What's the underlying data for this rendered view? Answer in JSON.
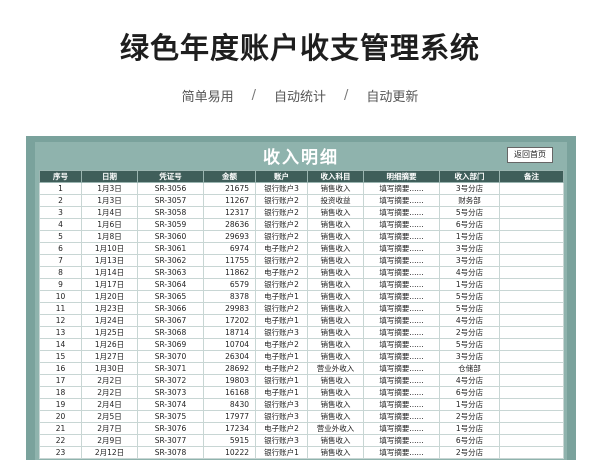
{
  "page": {
    "title": "绿色年度账户收支管理系统",
    "subtitle": [
      "简单易用",
      "自动统计",
      "自动更新"
    ],
    "separator": "/"
  },
  "sheet": {
    "title": "收入明细",
    "back_button": "返回首页",
    "columns": [
      "序号",
      "日期",
      "凭证号",
      "金额",
      "账户",
      "收入科目",
      "明细摘要",
      "收入部门",
      "备注"
    ],
    "rows": [
      [
        "1",
        "1月3日",
        "SR-3056",
        "21675",
        "银行账户3",
        "销售收入",
        "填写摘要......",
        "3号分店",
        ""
      ],
      [
        "2",
        "1月3日",
        "SR-3057",
        "11267",
        "银行账户2",
        "投资收益",
        "填写摘要......",
        "财务部",
        ""
      ],
      [
        "3",
        "1月4日",
        "SR-3058",
        "12317",
        "银行账户2",
        "销售收入",
        "填写摘要......",
        "5号分店",
        ""
      ],
      [
        "4",
        "1月6日",
        "SR-3059",
        "28636",
        "银行账户2",
        "销售收入",
        "填写摘要......",
        "6号分店",
        ""
      ],
      [
        "5",
        "1月8日",
        "SR-3060",
        "29693",
        "银行账户2",
        "销售收入",
        "填写摘要......",
        "1号分店",
        ""
      ],
      [
        "6",
        "1月10日",
        "SR-3061",
        "6974",
        "电子账户2",
        "销售收入",
        "填写摘要......",
        "3号分店",
        ""
      ],
      [
        "7",
        "1月13日",
        "SR-3062",
        "11755",
        "银行账户2",
        "销售收入",
        "填写摘要......",
        "3号分店",
        ""
      ],
      [
        "8",
        "1月14日",
        "SR-3063",
        "11862",
        "电子账户2",
        "销售收入",
        "填写摘要......",
        "4号分店",
        ""
      ],
      [
        "9",
        "1月17日",
        "SR-3064",
        "6579",
        "银行账户2",
        "销售收入",
        "填写摘要......",
        "1号分店",
        ""
      ],
      [
        "10",
        "1月20日",
        "SR-3065",
        "8378",
        "电子账户1",
        "销售收入",
        "填写摘要......",
        "5号分店",
        ""
      ],
      [
        "11",
        "1月23日",
        "SR-3066",
        "29983",
        "银行账户2",
        "销售收入",
        "填写摘要......",
        "5号分店",
        ""
      ],
      [
        "12",
        "1月24日",
        "SR-3067",
        "17202",
        "电子账户1",
        "销售收入",
        "填写摘要......",
        "4号分店",
        ""
      ],
      [
        "13",
        "1月25日",
        "SR-3068",
        "18714",
        "银行账户3",
        "销售收入",
        "填写摘要......",
        "2号分店",
        ""
      ],
      [
        "14",
        "1月26日",
        "SR-3069",
        "10704",
        "电子账户2",
        "销售收入",
        "填写摘要......",
        "5号分店",
        ""
      ],
      [
        "15",
        "1月27日",
        "SR-3070",
        "26304",
        "电子账户1",
        "销售收入",
        "填写摘要......",
        "3号分店",
        ""
      ],
      [
        "16",
        "1月30日",
        "SR-3071",
        "28692",
        "电子账户2",
        "营业外收入",
        "填写摘要......",
        "仓储部",
        ""
      ],
      [
        "17",
        "2月2日",
        "SR-3072",
        "19803",
        "银行账户1",
        "销售收入",
        "填写摘要......",
        "4号分店",
        ""
      ],
      [
        "18",
        "2月2日",
        "SR-3073",
        "16168",
        "电子账户1",
        "销售收入",
        "填写摘要......",
        "6号分店",
        ""
      ],
      [
        "19",
        "2月4日",
        "SR-3074",
        "8430",
        "银行账户3",
        "销售收入",
        "填写摘要......",
        "1号分店",
        ""
      ],
      [
        "20",
        "2月5日",
        "SR-3075",
        "17977",
        "银行账户3",
        "销售收入",
        "填写摘要......",
        "2号分店",
        ""
      ],
      [
        "21",
        "2月7日",
        "SR-3076",
        "17234",
        "电子账户2",
        "营业外收入",
        "填写摘要......",
        "1号分店",
        ""
      ],
      [
        "22",
        "2月9日",
        "SR-3077",
        "5915",
        "银行账户3",
        "销售收入",
        "填写摘要......",
        "6号分店",
        ""
      ],
      [
        "23",
        "2月12日",
        "SR-3078",
        "10222",
        "银行账户1",
        "销售收入",
        "填写摘要......",
        "2号分店",
        ""
      ]
    ]
  }
}
